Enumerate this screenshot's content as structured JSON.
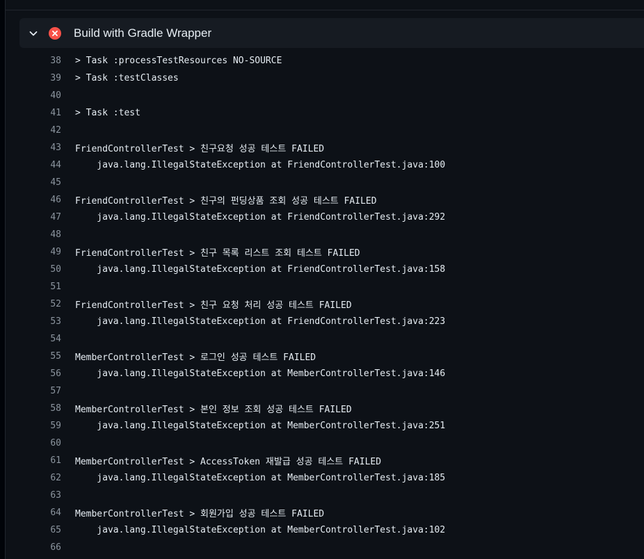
{
  "step": {
    "title": "Build with Gradle Wrapper",
    "expand_icon": "chevron-down-icon",
    "status_icon": "x-circle-fill-icon",
    "status_color": "#f85149"
  },
  "log": {
    "lines": [
      {
        "num": "38",
        "text": "> Task :processTestResources NO-SOURCE"
      },
      {
        "num": "39",
        "text": "> Task :testClasses"
      },
      {
        "num": "40",
        "text": ""
      },
      {
        "num": "41",
        "text": "> Task :test"
      },
      {
        "num": "42",
        "text": ""
      },
      {
        "num": "43",
        "text": "FriendControllerTest > 친구요청 성공 테스트 FAILED"
      },
      {
        "num": "44",
        "text": "    java.lang.IllegalStateException at FriendControllerTest.java:100"
      },
      {
        "num": "45",
        "text": ""
      },
      {
        "num": "46",
        "text": "FriendControllerTest > 친구의 펀딩상품 조회 성공 테스트 FAILED"
      },
      {
        "num": "47",
        "text": "    java.lang.IllegalStateException at FriendControllerTest.java:292"
      },
      {
        "num": "48",
        "text": ""
      },
      {
        "num": "49",
        "text": "FriendControllerTest > 친구 목록 리스트 조회 테스트 FAILED"
      },
      {
        "num": "50",
        "text": "    java.lang.IllegalStateException at FriendControllerTest.java:158"
      },
      {
        "num": "51",
        "text": ""
      },
      {
        "num": "52",
        "text": "FriendControllerTest > 친구 요청 처리 성공 테스트 FAILED"
      },
      {
        "num": "53",
        "text": "    java.lang.IllegalStateException at FriendControllerTest.java:223"
      },
      {
        "num": "54",
        "text": ""
      },
      {
        "num": "55",
        "text": "MemberControllerTest > 로그인 성공 테스트 FAILED"
      },
      {
        "num": "56",
        "text": "    java.lang.IllegalStateException at MemberControllerTest.java:146"
      },
      {
        "num": "57",
        "text": ""
      },
      {
        "num": "58",
        "text": "MemberControllerTest > 본인 정보 조회 성공 테스트 FAILED"
      },
      {
        "num": "59",
        "text": "    java.lang.IllegalStateException at MemberControllerTest.java:251"
      },
      {
        "num": "60",
        "text": ""
      },
      {
        "num": "61",
        "text": "MemberControllerTest > AccessToken 재발급 성공 테스트 FAILED"
      },
      {
        "num": "62",
        "text": "    java.lang.IllegalStateException at MemberControllerTest.java:185"
      },
      {
        "num": "63",
        "text": ""
      },
      {
        "num": "64",
        "text": "MemberControllerTest > 회원가입 성공 테스트 FAILED"
      },
      {
        "num": "65",
        "text": "    java.lang.IllegalStateException at MemberControllerTest.java:102"
      },
      {
        "num": "66",
        "text": ""
      }
    ]
  }
}
